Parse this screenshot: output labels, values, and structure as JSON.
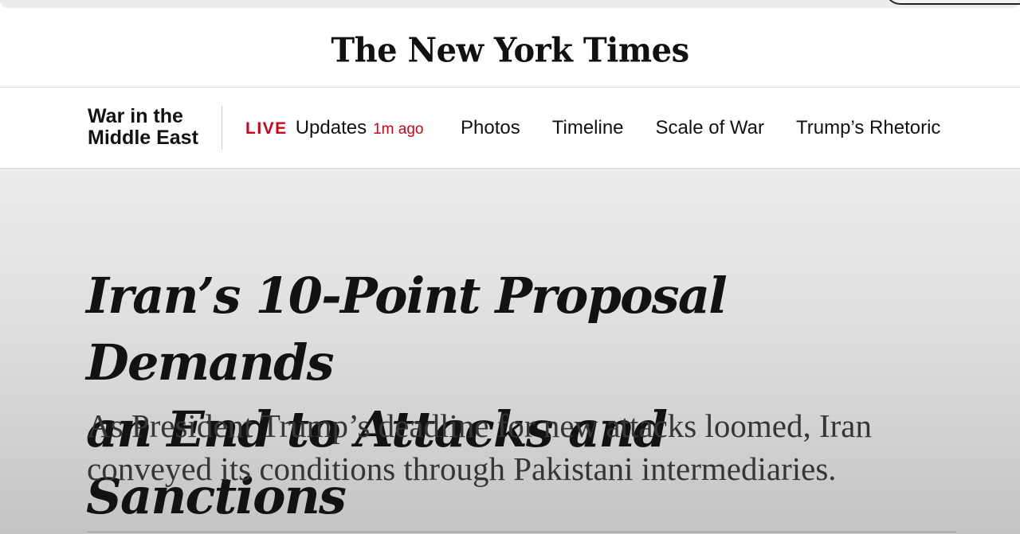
{
  "masthead": {
    "logo_text": "The New York Times"
  },
  "section_nav": {
    "section_title_line1": "War in the",
    "section_title_line2": "Middle East",
    "live": {
      "tag": "LIVE",
      "label": "Updates",
      "time": "1m ago"
    },
    "links": [
      {
        "label": "Photos"
      },
      {
        "label": "Timeline"
      },
      {
        "label": "Scale of War"
      },
      {
        "label": "Trump’s Rhetoric"
      }
    ]
  },
  "article": {
    "headline_line1": "Iran’s 10-Point Proposal Demands",
    "headline_line2": "an End to Attacks and Sanctions",
    "summary": "As President Trump’s deadline for new attacks loomed, Iran conveyed its conditions through Pakistani intermediaries."
  },
  "colors": {
    "live_red": "#d0021b",
    "text": "#121212",
    "summary_text": "#363636"
  }
}
